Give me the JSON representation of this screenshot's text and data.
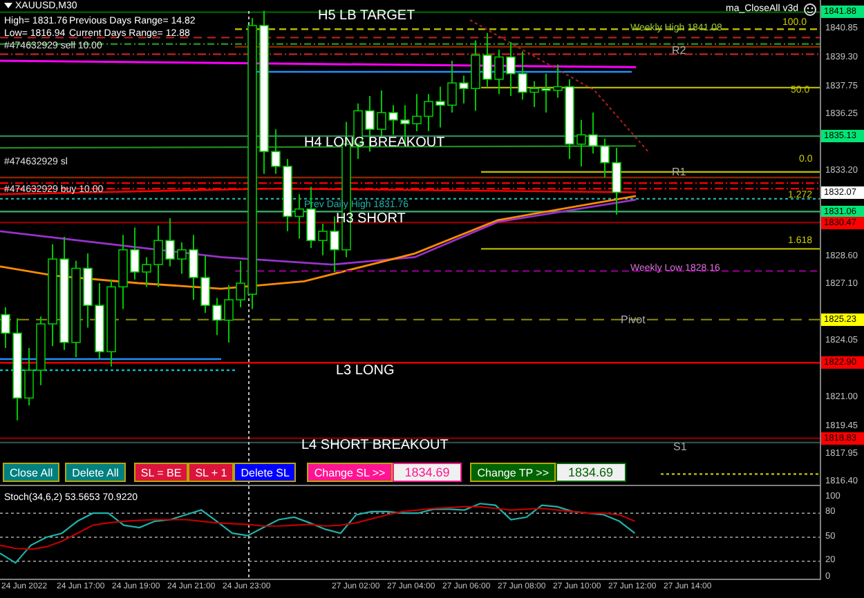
{
  "window": {
    "symbol": "XAUUSD,M30"
  },
  "info": [
    "High= 1831.76",
    "Previous Days Range= 14.82",
    "Low= 1816.94",
    "Current Days Range= 12.88"
  ],
  "trade_labels": [
    "#474632929 sell 10.00",
    "#474632929 sl",
    "#474632929 buy 10.00"
  ],
  "expert": {
    "name": "ma_CloseAll v3d"
  },
  "chart_labels": [
    {
      "text": "H5 LB TARGET",
      "kind": "level"
    },
    {
      "text": "Weekly High 1841.08",
      "kind": "weeklyhigh"
    },
    {
      "text": "100.0",
      "kind": "fib"
    },
    {
      "text": "R2",
      "kind": "pivot"
    },
    {
      "text": "50.0",
      "kind": "fib"
    },
    {
      "text": "H4 LONG BREAKOUT",
      "kind": "level"
    },
    {
      "text": "0.0",
      "kind": "fib"
    },
    {
      "text": "R1",
      "kind": "pivot"
    },
    {
      "text": "1.272",
      "kind": "fib"
    },
    {
      "text": "Prev Daily High 1831.76",
      "kind": "dailyhigh"
    },
    {
      "text": "H3 SHORT",
      "kind": "level"
    },
    {
      "text": "1.618",
      "kind": "fib"
    },
    {
      "text": "Weekly Low 1828.16",
      "kind": "weeklylow"
    },
    {
      "text": "Pivot",
      "kind": "pivot"
    },
    {
      "text": "L3 LONG",
      "kind": "level"
    },
    {
      "text": "L4 SHORT BREAKOUT",
      "kind": "level"
    },
    {
      "text": "S1",
      "kind": "pivot"
    }
  ],
  "controls": [
    {
      "kind": "button",
      "label": "Close All",
      "color": "#008080"
    },
    {
      "kind": "button",
      "label": "Delete All",
      "color": "#008080"
    },
    {
      "kind": "button",
      "label": "SL = BE",
      "color": "#dc143c"
    },
    {
      "kind": "button",
      "label": "SL + 1",
      "color": "#dc143c"
    },
    {
      "kind": "button",
      "label": "Delete SL",
      "color": "#0000ff"
    },
    {
      "kind": "button",
      "label": "Change SL >>",
      "color": "#ff1493"
    },
    {
      "kind": "field",
      "value": "1834.69",
      "color": "#ff1493"
    },
    {
      "kind": "button",
      "label": "Change TP >>",
      "color": "#006400"
    },
    {
      "kind": "field",
      "value": "1834.69",
      "color": "#006400"
    }
  ],
  "price_axis": {
    "ticks": [
      "1840.85",
      "1839.30",
      "1837.75",
      "1836.25",
      "1833.20",
      "1828.60",
      "1827.10",
      "1824.05",
      "1821.00",
      "1819.45",
      "1817.95",
      "1816.40"
    ],
    "markers": [
      {
        "label": "1841.88",
        "color": "#00e676"
      },
      {
        "label": "1835.13",
        "color": "#00e676"
      },
      {
        "label": "1832.07",
        "color": "#ffffff"
      },
      {
        "label": "1831.06",
        "color": "#00e676"
      },
      {
        "label": "1830.47",
        "color": "#ff0000"
      },
      {
        "label": "1825.23",
        "color": "#ffff00"
      },
      {
        "label": "1822.90",
        "color": "#ff0000"
      },
      {
        "label": "1818.83",
        "color": "#ff0000"
      }
    ]
  },
  "stoch": {
    "label": "Stoch(34,6,2) 53.5653 70.9220",
    "ticks": [
      "100",
      "80",
      "50",
      "20",
      "0"
    ]
  },
  "time_axis": [
    "24 Jun 2022",
    "24 Jun 17:00",
    "24 Jun 19:00",
    "24 Jun 21:00",
    "24 Jun 23:00",
    "27 Jun 02:00",
    "27 Jun 04:00",
    "27 Jun 06:00",
    "27 Jun 08:00",
    "27 Jun 10:00",
    "27 Jun 12:00",
    "27 Jun 14:00"
  ]
}
